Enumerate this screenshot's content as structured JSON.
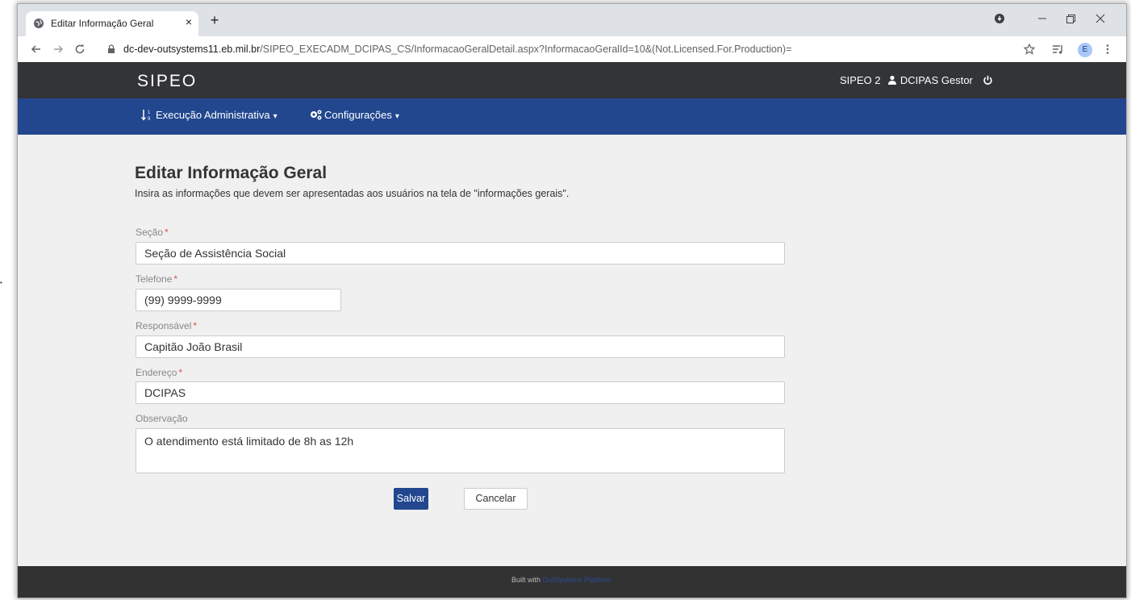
{
  "browser": {
    "tab_title": "Editar Informação Geral",
    "tab_close": "×",
    "new_tab": "+",
    "url_host": "dc-dev-outsystems11.eb.mil.br",
    "url_path": "/SIPEO_EXECADM_DCIPAS_CS/InformacaoGeralDetail.aspx?InformacaoGeralId=10&(Not.Licensed.For.Production)=",
    "profile_initial": "E",
    "icons": [
      "globe-icon",
      "back-icon",
      "forward-icon",
      "reload-icon",
      "lock-icon",
      "star-icon",
      "reading-list-icon",
      "menu-kebab-icon",
      "record-icon",
      "minimize-icon",
      "restore-icon",
      "close-window-icon"
    ]
  },
  "header": {
    "brand": "SIPEO",
    "system": "SIPEO 2",
    "user": "DCIPAS Gestor",
    "icons": [
      "user-icon",
      "power-icon"
    ]
  },
  "menu": {
    "items": [
      {
        "label": "Execução Administrativa",
        "icon": "sort-icon"
      },
      {
        "label": "Configurações",
        "icon": "cogs-icon"
      }
    ]
  },
  "form": {
    "title": "Editar Informação Geral",
    "description": "Insira as informações que devem ser apresentadas aos usuários na tela de \"informações gerais\".",
    "fields": [
      {
        "label": "Seção",
        "required": "*",
        "value": "Seção de Assistência Social"
      },
      {
        "label": "Telefone",
        "required": "*",
        "value": "(99) 9999-9999"
      },
      {
        "label": "Responsável",
        "required": "*",
        "value": "Capitão João Brasil"
      },
      {
        "label": "Endereço",
        "required": "*",
        "value": "DCIPAS"
      },
      {
        "label": "Observação",
        "required": "",
        "value": "O atendimento está limitado de 8h as 12h"
      }
    ],
    "save_label": "Salvar",
    "cancel_label": "Cancelar"
  },
  "footer": {
    "prefix": "Built with",
    "link": "OutSystems Platform"
  },
  "colors": {
    "header_bg": "#333436",
    "menu_bg": "#22478f",
    "primary_button": "#22478f",
    "required_mark": "#d9534f"
  }
}
